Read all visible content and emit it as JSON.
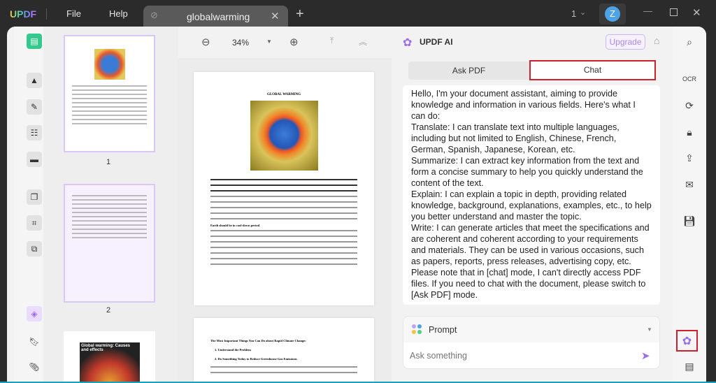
{
  "titlebar": {
    "logo": "UPDF",
    "menu": [
      "File",
      "Help"
    ],
    "tab_title": "globalwarming",
    "window_count": "1",
    "avatar_letter": "Z"
  },
  "doc_toolbar": {
    "zoom": "34%"
  },
  "thumbnails": [
    {
      "page": "1"
    },
    {
      "page": "2"
    }
  ],
  "thumbnail3_title": "Global warming: Causes and effects",
  "page1": {
    "title": "GLOBAL WARMING",
    "heading": "Earth should be in cool-down period"
  },
  "page2": {
    "heading": "The Most Important Things You Can Do about Rapid Climate Change:",
    "item1": "1.  Understand the Problem",
    "item2": "2. Do Something Today to Reduce Greenhouse Gas Emissions"
  },
  "ai": {
    "title": "UPDF AI",
    "upgrade": "Upgrade",
    "tabs": [
      "Ask PDF",
      "Chat"
    ],
    "active_tab": "Chat",
    "messages": [
      "Hello, I'm your document assistant, aiming to provide knowledge and information in various fields. Here's what I can do:",
      "Translate: I can translate text into multiple languages, including but not limited to English, Chinese, French, German, Spanish, Japanese, Korean, etc.",
      "Summarize: I can extract key information from the text and form a concise summary to help you quickly understand the content of the text.",
      "Explain: I can explain a topic in depth, providing related knowledge, background, explanations, examples, etc., to help you better understand and master the topic.",
      "Write: I can generate articles that meet the specifications and are coherent and coherent according to your requirements and materials. They can be used in various occasions, such as papers, reports, press releases, advertising copy, etc.",
      "Please note that in [chat] mode, I can't directly access PDF files. If you need to chat with the document, please switch to [Ask PDF] mode."
    ],
    "prompt_label": "Prompt",
    "input_placeholder": "Ask something"
  },
  "colors": {
    "accent_purple": "#9b6bf2",
    "highlight_red": "#d0202e",
    "active_green": "#35c98f"
  }
}
